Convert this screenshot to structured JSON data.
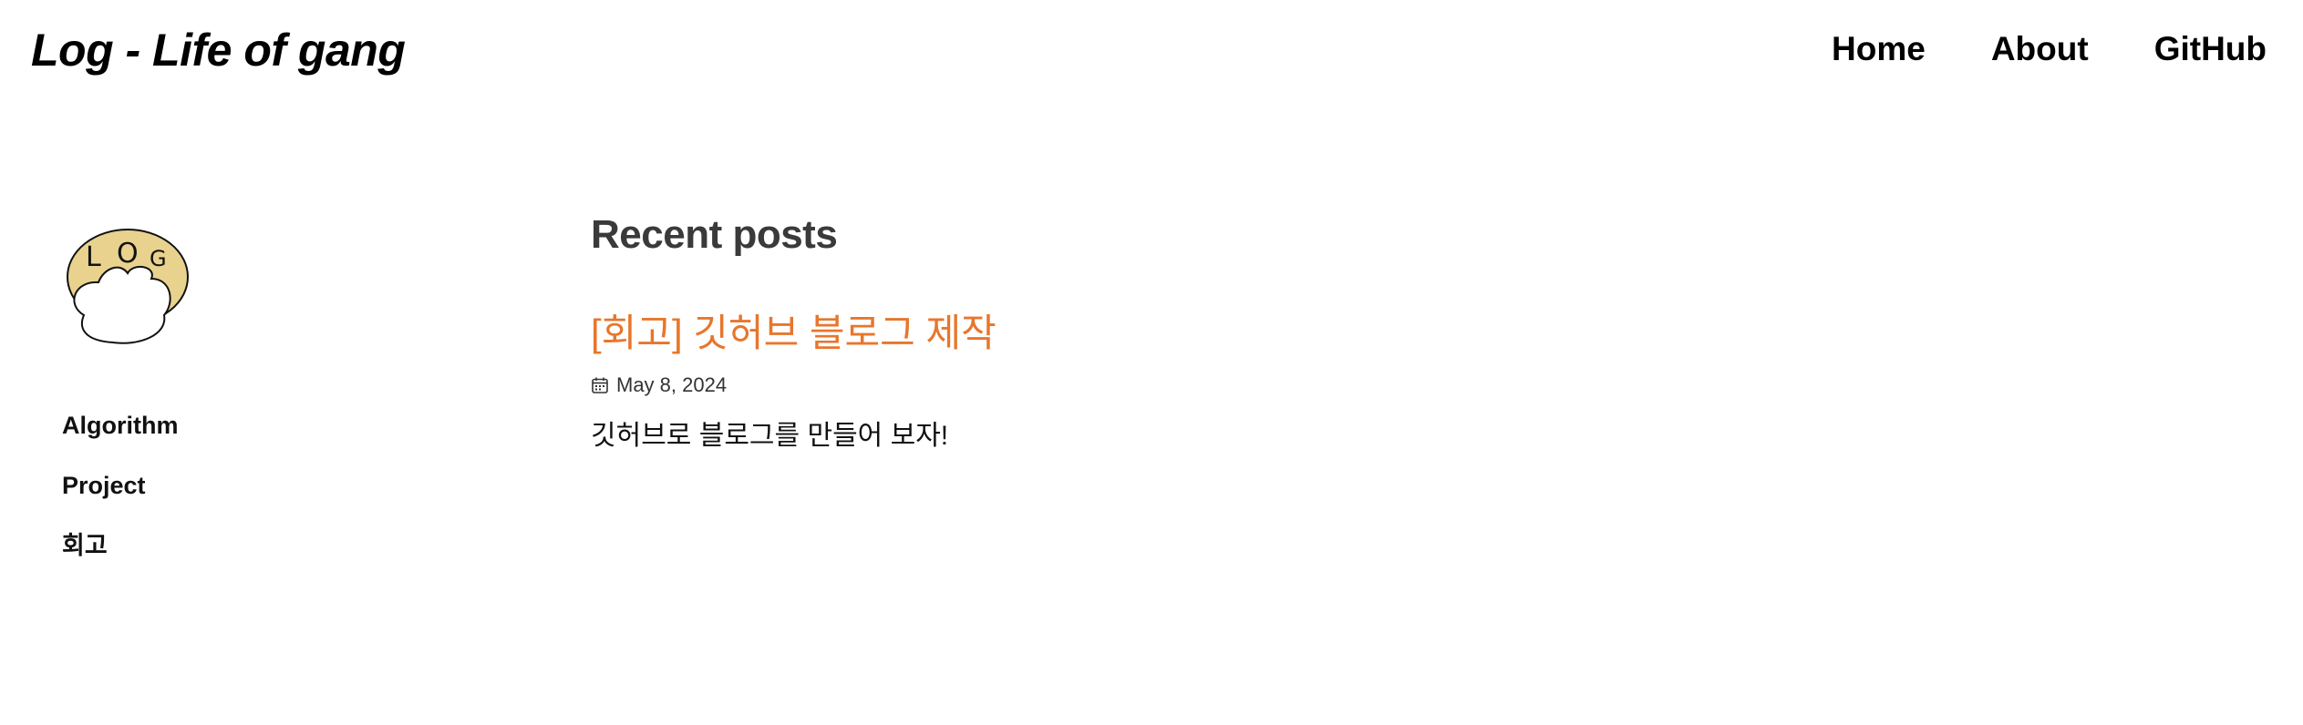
{
  "site": {
    "title": "Log - Life of gang"
  },
  "nav": {
    "items": [
      {
        "label": "Home"
      },
      {
        "label": "About"
      },
      {
        "label": "GitHub"
      }
    ]
  },
  "sidebar": {
    "avatar": {
      "icon": "log-blob-logo",
      "text": "LOG",
      "colors": {
        "fill_back": "#e9d28e",
        "fill_front": "#ffffff",
        "stroke": "#111111"
      }
    },
    "categories": [
      {
        "label": "Algorithm"
      },
      {
        "label": "Project"
      },
      {
        "label": "회고"
      }
    ]
  },
  "main": {
    "section_title": "Recent posts",
    "posts": [
      {
        "title": "[회고] 깃허브 블로그 제작",
        "date": "May 8, 2024",
        "date_icon": "calendar-icon",
        "excerpt": "깃허브로 블로그를 만들어 보자!"
      }
    ]
  },
  "colors": {
    "accent": "#e8762c",
    "heading": "#3a3a3a",
    "text": "#111111"
  }
}
